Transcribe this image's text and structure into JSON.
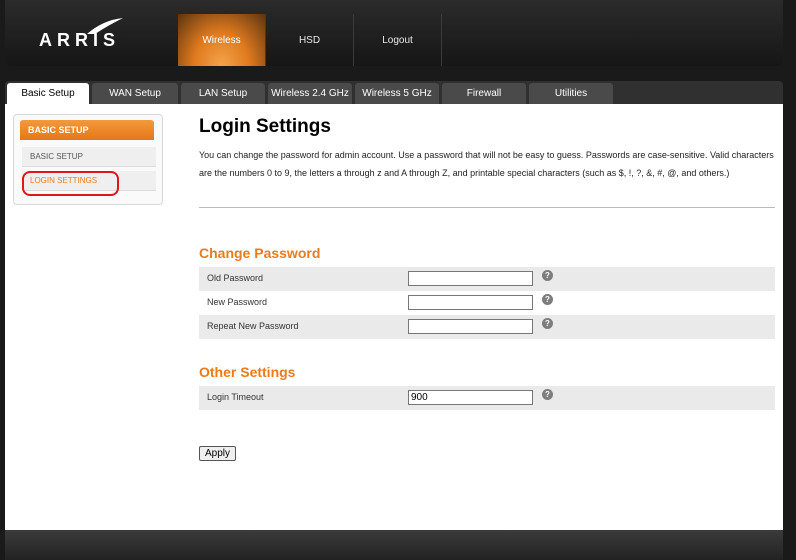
{
  "brand": {
    "logo_text": "ARRIS"
  },
  "top_nav": [
    "Wireless",
    "HSD",
    "Logout"
  ],
  "tabs": [
    "Basic Setup",
    "WAN Setup",
    "LAN Setup",
    "Wireless 2.4 GHz",
    "Wireless 5 GHz",
    "Firewall",
    "Utilities"
  ],
  "sidebar": {
    "heading": "BASIC SETUP",
    "items": [
      "BASIC SETUP",
      "LOGIN SETTINGS"
    ]
  },
  "main": {
    "title": "Login Settings",
    "description": "You can change the password for admin account. Use a password that will not be easy to guess. Passwords are case-sensitive. Valid characters are the numbers 0 to 9, the letters a through z and A through Z, and printable special characters (such as $, !, ?, &, #, @, and others.)",
    "change_password": {
      "title": "Change Password",
      "old_label": "Old Password",
      "new_label": "New Password",
      "repeat_label": "Repeat New Password",
      "old_value": "",
      "new_value": "",
      "repeat_value": ""
    },
    "other_settings": {
      "title": "Other Settings",
      "timeout_label": "Login Timeout",
      "timeout_value": "900"
    },
    "help_glyph": "?",
    "apply_label": "Apply"
  },
  "colors": {
    "accent": "#ee7b1b",
    "annotation": "#e0161c"
  }
}
